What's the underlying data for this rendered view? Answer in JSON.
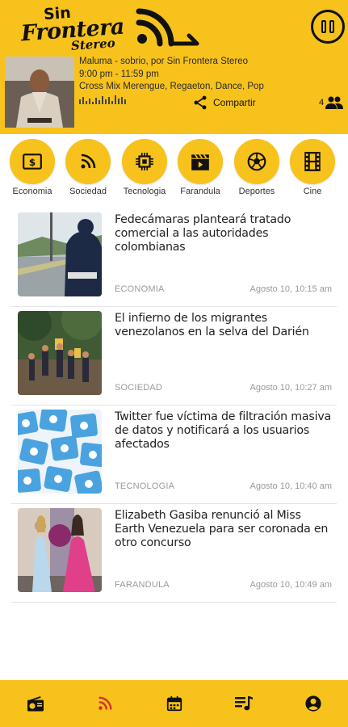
{
  "app": {
    "logo_text": [
      "Sin",
      "Frontera",
      "Stereo"
    ]
  },
  "player": {
    "show_line": "Maluma  - sobrio, por Sin Frontera Stereo",
    "time_line": "9:00 pm - 11:59 pm",
    "program_line": "Cross Mix  Merengue, Regaeton, Dance, Pop",
    "share_label": "Compartir",
    "listener_count": "4",
    "state": "playing"
  },
  "categories": [
    {
      "label": "Economia",
      "icon": "money-icon"
    },
    {
      "label": "Sociedad",
      "icon": "rss-icon"
    },
    {
      "label": "Tecnologia",
      "icon": "chip-icon"
    },
    {
      "label": "Farandula",
      "icon": "clapperboard-icon"
    },
    {
      "label": "Deportes",
      "icon": "soccer-ball-icon"
    },
    {
      "label": "Cine",
      "icon": "film-icon"
    }
  ],
  "news": [
    {
      "title": "Fedecámaras planteará tratado comercial a las autoridades colombianas",
      "category": "ECONOMIA",
      "date": "Agosto 10, 10:15 am"
    },
    {
      "title": "El infierno de los migrantes venezolanos en la selva del Darién",
      "category": "SOCIEDAD",
      "date": "Agosto 10, 10:27 am"
    },
    {
      "title": "Twitter fue víctima de filtración masiva de datos y notificará a los usuarios afectados",
      "category": "TECNOLOGIA",
      "date": "Agosto 10, 10:40 am"
    },
    {
      "title": "Elizabeth Gasiba renunció al Miss Earth Venezuela para ser coronada en otro concurso",
      "category": "FARANDULA",
      "date": "Agosto 10, 10:49 am"
    }
  ],
  "bottom_nav": [
    {
      "icon": "radio-icon",
      "active": false
    },
    {
      "icon": "rss-icon",
      "active": true
    },
    {
      "icon": "calendar-icon",
      "active": false
    },
    {
      "icon": "playlist-icon",
      "active": false
    },
    {
      "icon": "account-icon",
      "active": false
    }
  ],
  "colors": {
    "brand_yellow": "#f7c21b",
    "active_nav": "#d32f2f",
    "text_muted": "#9a9a9a"
  }
}
